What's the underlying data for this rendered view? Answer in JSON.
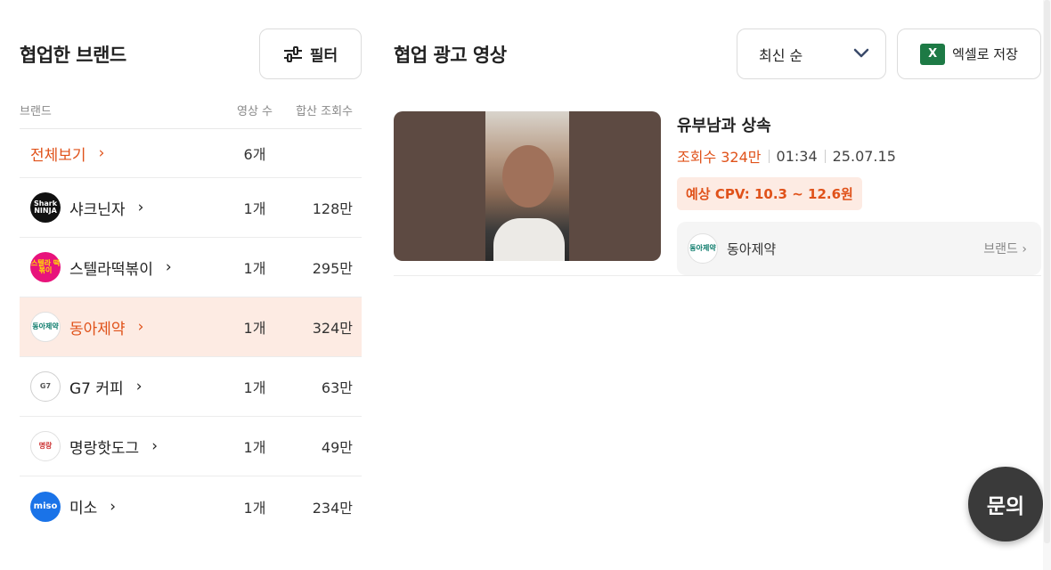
{
  "left": {
    "title": "협업한 브랜드",
    "filter_label": "필터",
    "headers": {
      "brand": "브랜드",
      "count": "영상 수",
      "views": "합산 조회수"
    },
    "rows": [
      {
        "name": "전체보기",
        "count": "6개",
        "views": "",
        "logo": ""
      },
      {
        "name": "샤크닌자",
        "count": "1개",
        "views": "128만",
        "logo": "Shark NINJA"
      },
      {
        "name": "스텔라떡볶이",
        "count": "1개",
        "views": "295만",
        "logo": "스텔라 떡볶이"
      },
      {
        "name": "동아제약",
        "count": "1개",
        "views": "324만",
        "logo": "동아제약"
      },
      {
        "name": "G7 커피",
        "count": "1개",
        "views": "63만",
        "logo": "G7"
      },
      {
        "name": "명랑핫도그",
        "count": "1개",
        "views": "49만",
        "logo": "명랑"
      },
      {
        "name": "미소",
        "count": "1개",
        "views": "234만",
        "logo": "miso"
      }
    ]
  },
  "right": {
    "title": "협업 광고 영상",
    "sort_value": "최신 순",
    "excel_label": "엑셀로 저장",
    "excel_icon_text": "X",
    "video": {
      "title": "유부남과 상속",
      "views": "조회수 324만",
      "duration": "01:34",
      "date": "25.07.15",
      "cpv": "예상 CPV: 10.3 ~ 12.6원",
      "brand_name": "동아제약",
      "brand_logo": "동아제약",
      "brand_link": "브랜드"
    }
  },
  "inquiry_label": "문의",
  "colors": {
    "accent": "#e0521a",
    "active_row_bg": "#fdebe3",
    "excel_green": "#1d7a45"
  }
}
